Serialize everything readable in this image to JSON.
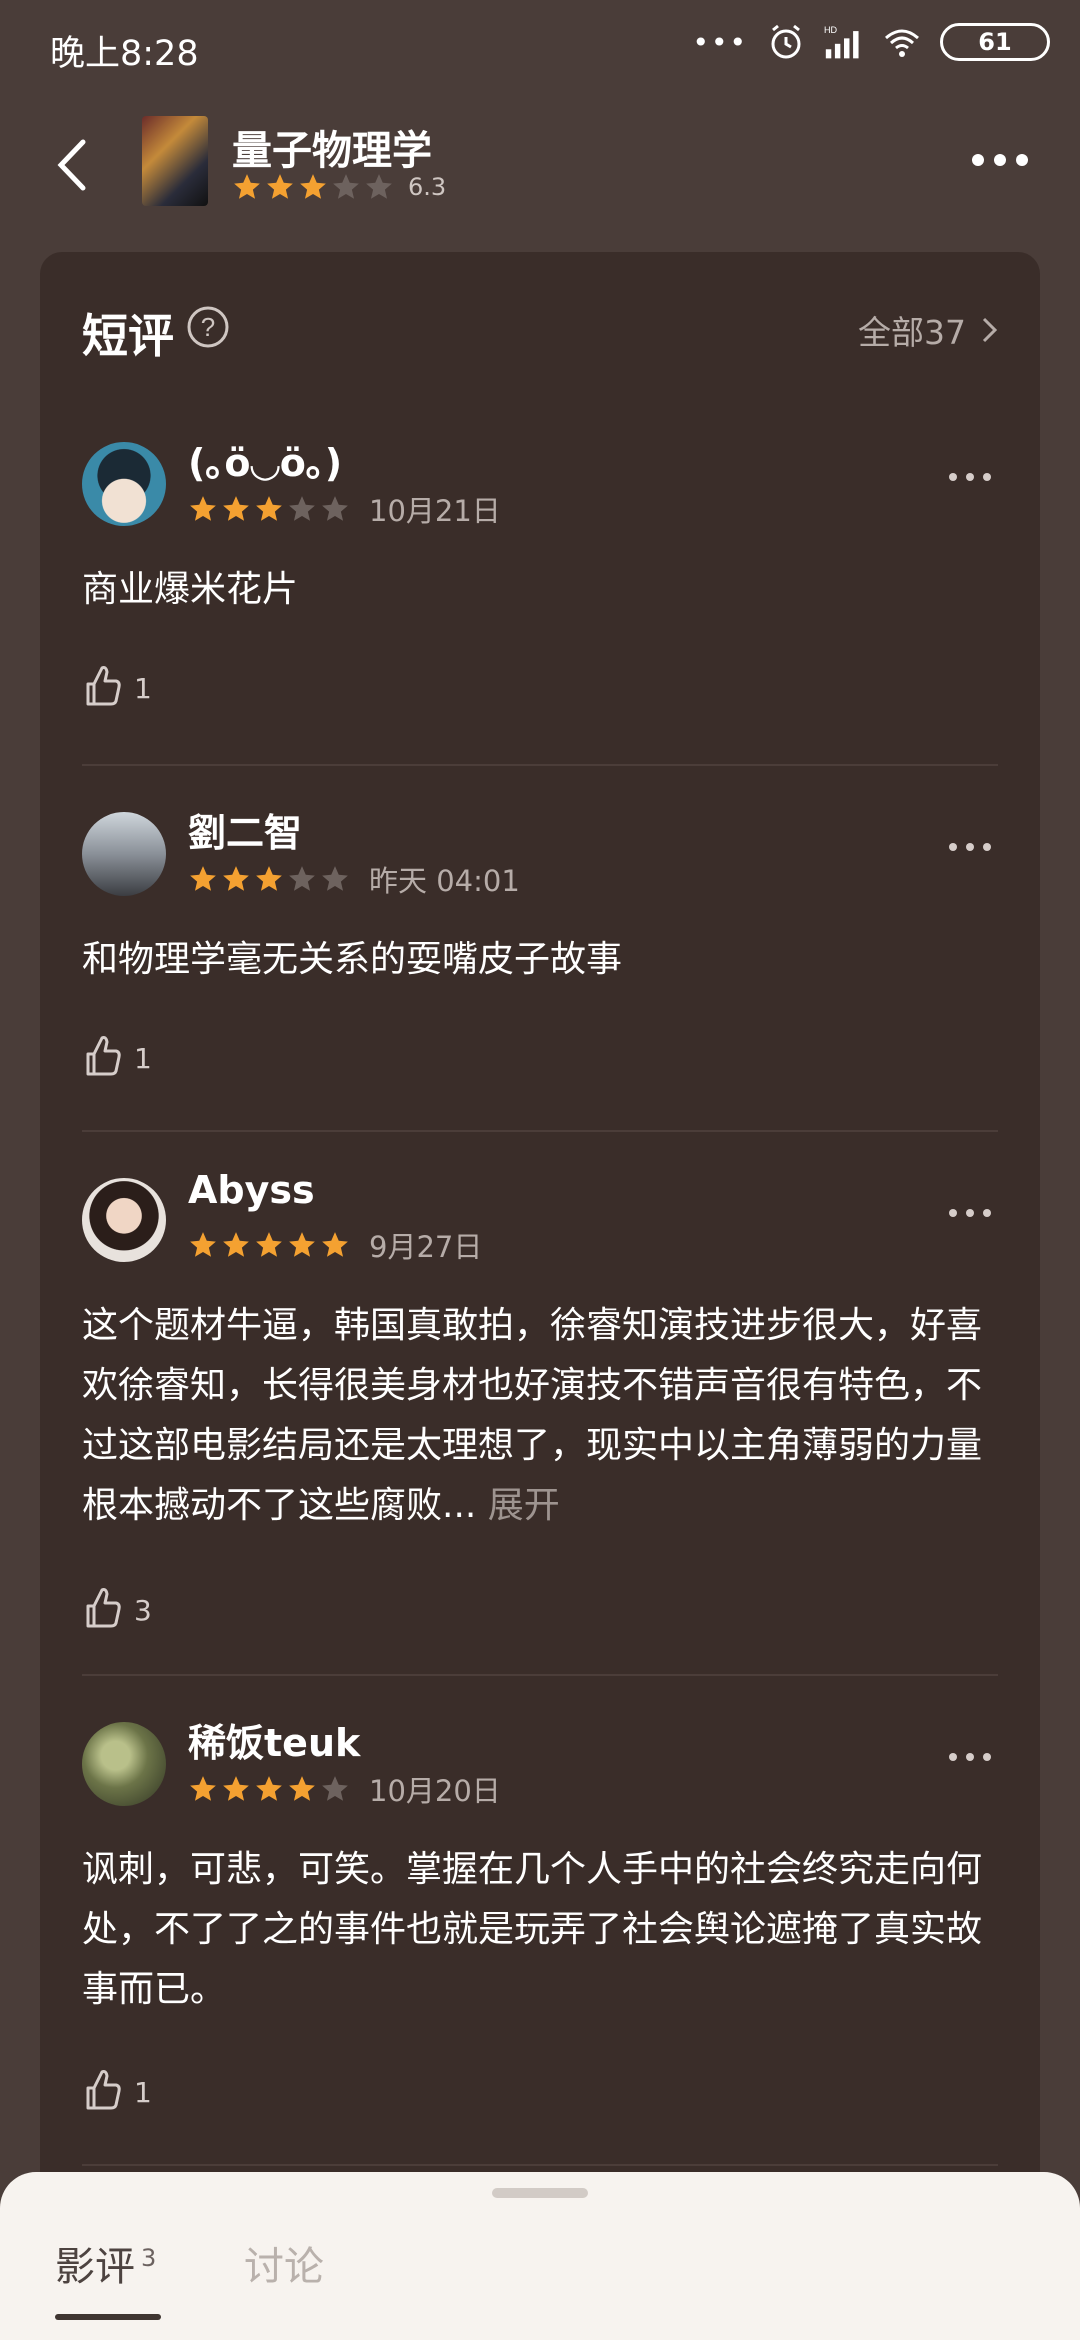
{
  "status": {
    "time": "晚上8:28",
    "battery": "61",
    "network": "HD"
  },
  "header": {
    "title": "量子物理学",
    "rating": "6.3",
    "stars": 3
  },
  "section": {
    "title": "短评",
    "all_label": "全部37"
  },
  "reviews": [
    {
      "name": "(｡ö◡ö｡)",
      "stars": 3,
      "date": "10月21日",
      "text": "商业爆米花片",
      "likes": "1"
    },
    {
      "name": "劉二智",
      "stars": 3,
      "date": "昨天 04:01",
      "text": "和物理学毫无关系的耍嘴皮子故事",
      "likes": "1"
    },
    {
      "name": "Abyss",
      "stars": 5,
      "date": "9月27日",
      "text": "这个题材牛逼，韩国真敢拍，徐睿知演技进步很大，好喜欢徐睿知，长得很美身材也好演技不错声音很有特色，不过这部电影结局还是太理想了，现实中以主角薄弱的力量根本撼动不了这些腐败...",
      "expand": "展开",
      "likes": "3"
    },
    {
      "name": "稀饭teuk",
      "stars": 4,
      "date": "10月20日",
      "text": "讽刺，可悲，可笑。掌握在几个人手中的社会终究走向何处，不了了之的事件也就是玩弄了社会舆论遮掩了真实故事而已。",
      "likes": "1"
    }
  ],
  "tabs": {
    "active": "影评",
    "active_count": "3",
    "inactive": "讨论"
  },
  "colors": {
    "bg": "#4a3d39",
    "card": "#3a2d29",
    "star": "#f4a131",
    "star_empty": "#6d625e"
  }
}
